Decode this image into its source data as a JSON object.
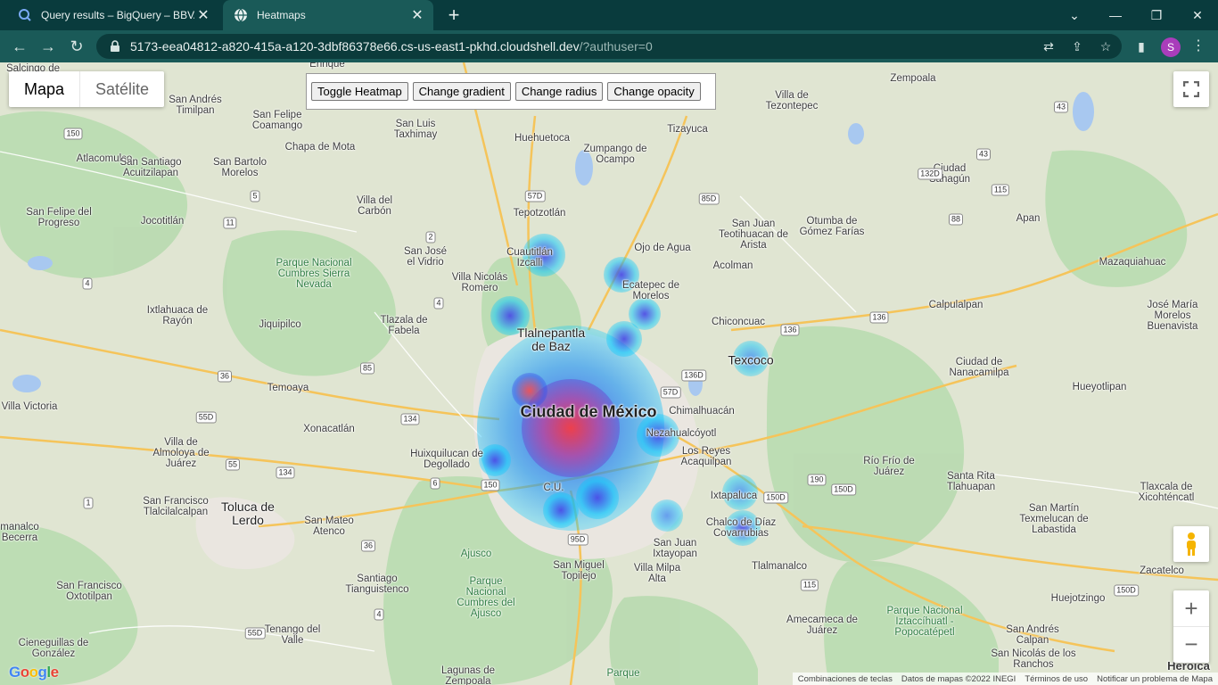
{
  "browser": {
    "tabs": [
      {
        "title": "Query results – BigQuery – BBVA",
        "active": false,
        "icon": "bigquery-icon"
      },
      {
        "title": "Heatmaps",
        "active": true,
        "icon": "globe-icon"
      }
    ],
    "url_host": "5173-eea04812-a820-415a-a120-3dbf86378e66.cs-us-east1-pkhd.cloudshell.dev",
    "url_path": "/?authuser=0",
    "profile_initial": "S",
    "colors": {
      "tabstrip": "#093b3d",
      "toolbar": "#1a5a58",
      "profile": "#a93dbb"
    }
  },
  "map": {
    "map_type": {
      "map": "Mapa",
      "satellite": "Satélite",
      "selected": "Mapa"
    },
    "panel_buttons": [
      "Toggle Heatmap",
      "Change gradient",
      "Change radius",
      "Change opacity"
    ],
    "attribution": [
      "Combinaciones de teclas",
      "Datos de mapas ©2022 INEGI",
      "Términos de uso",
      "Notificar un problema de Mapa"
    ],
    "logo": "Google",
    "places": {
      "cdmx": "Ciudad de México",
      "tlalnepantla": "Tlalnepantla de Baz",
      "texcoco": "Texcoco",
      "toluca": "Toluca de Lerdo",
      "nezahualcoyotl": "Nezahualcóyotl",
      "ecatepec": "Ecatepec de Morelos",
      "chimalhuacan": "Chimalhuacán",
      "reyes": "Los Reyes Acaquilpan",
      "ixtapaluca": "Ixtapaluca",
      "chalco": "Chalco de Díaz Covarrubias",
      "cuautitlan": "Cuautitlán Izcalli",
      "villa_nicolas": "Villa Nicolás Romero",
      "naucalpan_huix": "Huixquilucan de Degollado",
      "tlalpan_cu": "C.U.",
      "xonacatlan": "Xonacatlán",
      "temoaya": "Temoaya",
      "jiquipilco": "Jiquipilco",
      "ixtlahuaca": "Ixtlahuaca de Rayón",
      "atlacomulco": "Atlacomulco",
      "acuitzilapan": "San Santiago Acuitzilapan",
      "san_bartolo": "San Bartolo Morelos",
      "san_felipe_coamango": "San Felipe Coamango",
      "chapa_de_mota": "Chapa de Mota",
      "villa_del_carbon": "Villa del Carbón",
      "san_luis_taxhimay": "San Luis Taxhimay",
      "huehuetoca": "Huehuetoca",
      "zumpango": "Zumpango de Ocampo",
      "tepotzotlan": "Tepotzotlán",
      "tizayuca": "Tizayuca",
      "villa_tezontepec": "Villa de Tezontepec",
      "zempoala": "Zempoala",
      "ciudad_sahagun": "Ciudad Sahagún",
      "apan": "Apan",
      "otumba": "Otumba de Gómez Farías",
      "san_juan_teo": "San Juan Teotihuacan de Arista",
      "ojo_de_agua": "Ojo de Agua",
      "acolman": "Acolman",
      "chiconcuac": "Chiconcuac",
      "calpulalpan": "Calpulalpan",
      "mazaquiahuac": "Mazaquiahuac",
      "jose_maria_morelos": "José María Morelos Buenavista",
      "nanacamilpa": "Ciudad de Nanacamilpa",
      "hueyotlipan": "Hueyotlipan",
      "rio_frio": "Río Frío de Juárez",
      "santa_rita": "Santa Rita Tlahuapan",
      "tlaxcala_xicohtencatl": "Tlaxcala de Xicohténcatl",
      "san_martin": "San Martín Texmelucan de Labastida",
      "san_jose_el_vidrio": "San José el Vidrio",
      "tlazala": "Tlazala de Fabela",
      "parque_cumbres": "Parque Nacional Cumbres Sierra Nevada",
      "san_felipe_progreso": "San Felipe del Progreso",
      "jocotitlan": "Jocotitlán",
      "villa_victoria": "Villa Victoria",
      "almoloya": "Villa de Almoloya de Juárez",
      "san_francisco_tlalcilalcalpan": "San Francisco Tlalcilalcalpan",
      "san_mateo_atenco": "San Mateo Atenco",
      "santiago_tianguistenco": "Santiago Tianguistenco",
      "ajusco": "Ajusco",
      "parque_ajusco": "Parque Nacional Cumbres del Ajusco",
      "san_miguel_topilejo": "San Miguel Topilejo",
      "san_juan_ixtayopan": "San Juan Ixtayopan",
      "milpa_alta": "Villa Milpa Alta",
      "tlalmanalco": "Tlalmanalco",
      "amecameca": "Amecameca de Juárez",
      "parque_izta": "Parque Nacional Iztaccíhuatl - Popocatépetl",
      "san_andres_calpan": "San Andrés Calpan",
      "san_nicolas_ranchos": "San Nicolás de los Ranchos",
      "huejotzingo": "Huejotzingo",
      "zacatelco": "Zacatelco",
      "heroica": "Heroica",
      "tenango": "Tenango del Valle",
      "lagunas": "Lagunas de Zempoala",
      "parque_bottom": "Parque",
      "san_francisco_oxtotilpan": "San Francisco Oxtotilpan",
      "cieneguillas": "Cieneguillas de González",
      "san_andres_timilpan": "San Andrés Timilpan",
      "enrique": "Enrique",
      "calcingo": "Salcingo de",
      "manalco": "manalco Becerra"
    },
    "heat_color_low": "#00c8ff",
    "heat_color_mid": "#3333cc",
    "heat_color_high": "#ff3333"
  }
}
